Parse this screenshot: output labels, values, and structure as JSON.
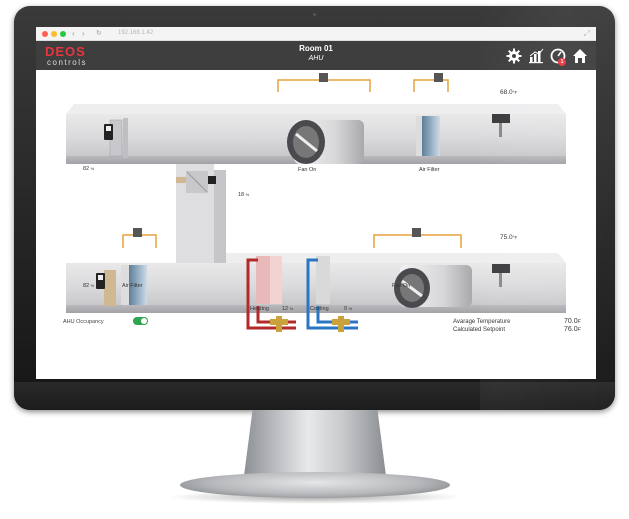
{
  "browser": {
    "url_text": "192.168.1.42"
  },
  "header": {
    "logo_mark": "DEOS",
    "logo_sub": "controls",
    "title": "Room 01",
    "subtitle": "AHU",
    "alarm_count": "1",
    "icons": [
      "gear-icon",
      "chart-icon",
      "alarm-gauge-icon",
      "home-icon"
    ]
  },
  "upper_duct": {
    "damper_percent": "82",
    "fan_label": "Fan On",
    "filter_label": "Air Filter",
    "temperature": "68.0",
    "temp_unit": "°F"
  },
  "mixing_damper": {
    "percent": "18"
  },
  "lower_duct": {
    "damper_percent": "82",
    "filter_label": "Air Filter",
    "fan_label": "Fan On",
    "temperature": "75.0",
    "temp_unit": "°F",
    "heating_label": "Heating",
    "heating_percent": "12",
    "cooling_label": "Cooling",
    "cooling_percent": "0"
  },
  "percent_unit": "%",
  "occupancy": {
    "label": "AHU Occupancy",
    "state": true
  },
  "summary": {
    "avg_temp_label": "Avarage Temperature",
    "avg_temp_value": "70.0",
    "setpoint_label": "Calculated Setpoint",
    "setpoint_value": "76.0",
    "unit": "F"
  },
  "colors": {
    "brand": "#e8353f",
    "header_bg": "#3e3e3e",
    "heating_pipe": "#b22a2a",
    "cooling_pipe": "#2b76c4",
    "control_line": "#e6a23c",
    "toggle_on": "#2ea44f"
  }
}
